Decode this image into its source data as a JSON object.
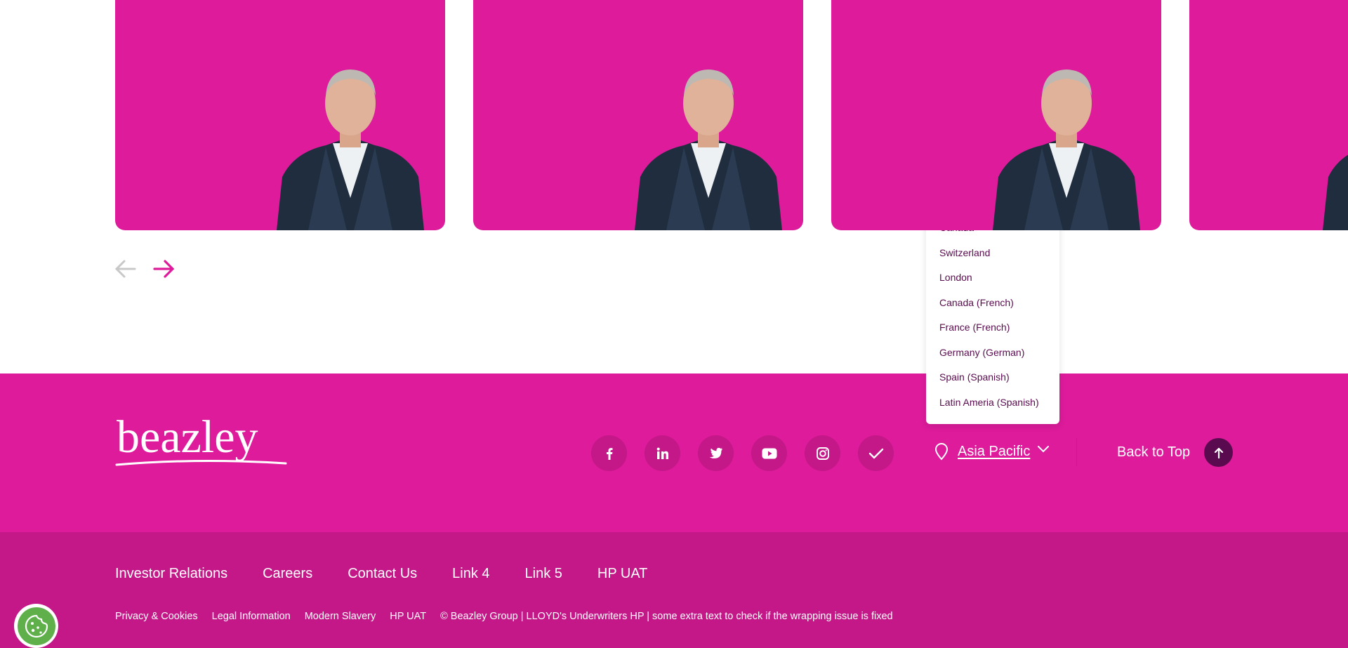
{
  "carousel": {
    "cards": [
      {
        "image": "portrait-man-in-suit"
      },
      {
        "image": "portrait-man-in-suit"
      },
      {
        "image": "portrait-man-in-suit"
      },
      {
        "image": "portrait-man-in-suit"
      }
    ],
    "prev_icon": "arrow-left-icon",
    "next_icon": "arrow-right-icon",
    "prev_color": "#c8c8c8",
    "next_color": "#dd1b9b"
  },
  "colors": {
    "brand_pink": "#dd1b9b",
    "brand_pink_dark": "#c41788",
    "plum": "#5a0b4f"
  },
  "footer": {
    "logo_text": "beazley",
    "socials": [
      {
        "name": "facebook-icon"
      },
      {
        "name": "linkedin-icon"
      },
      {
        "name": "twitter-icon"
      },
      {
        "name": "youtube-icon"
      },
      {
        "name": "instagram-icon"
      },
      {
        "name": "check-icon"
      }
    ],
    "region": {
      "selected": "Asia Pacific",
      "options": [
        "Canada",
        "Switzerland",
        "London",
        "Canada (French)",
        "France (French)",
        "Germany (German)",
        "Spain (Spanish)",
        "Latin Ameria (Spanish)"
      ]
    },
    "back_to_top": "Back to Top",
    "primary_links": [
      "Investor Relations",
      "Careers",
      "Contact Us",
      "Link 4",
      "Link 5",
      "HP UAT"
    ],
    "legal_links": [
      "Privacy & Cookies",
      "Legal Information",
      "Modern Slavery",
      "HP UAT"
    ],
    "copyright": "© Beazley Group | LLOYD's Underwriters HP | some extra text to check if the wrapping issue is fixed"
  },
  "cookie_button": {
    "icon": "cookie-icon"
  }
}
